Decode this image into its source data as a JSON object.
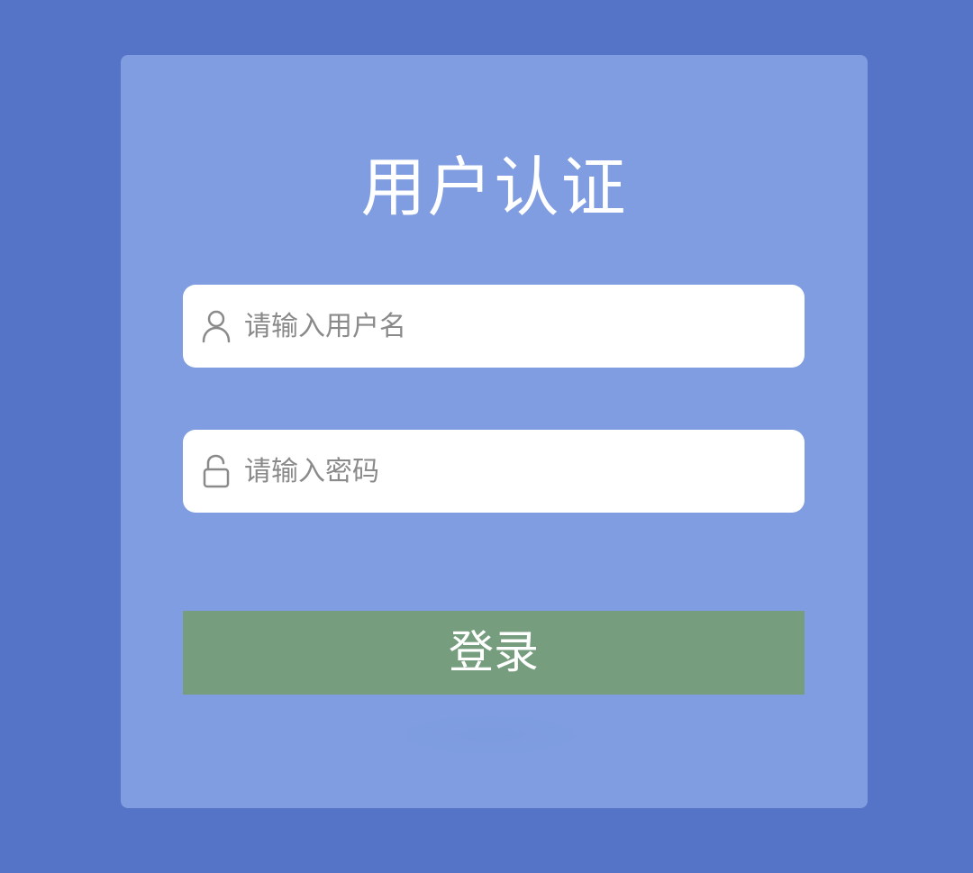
{
  "login": {
    "title": "用户认证",
    "username": {
      "placeholder": "请输入用户名",
      "value": "",
      "icon": "user-icon"
    },
    "password": {
      "placeholder": "请输入密码",
      "value": "",
      "icon": "unlock-icon"
    },
    "submit_label": "登录"
  },
  "colors": {
    "background": "#5574c7",
    "card": "#7f9de0",
    "button": "#769e7e",
    "input_bg": "#ffffff",
    "placeholder": "#8a8a8a"
  }
}
